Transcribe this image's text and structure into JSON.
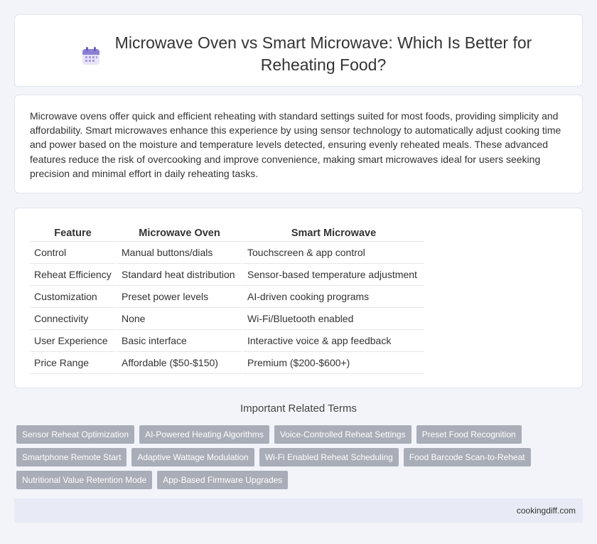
{
  "header": {
    "title": "Microwave Oven vs Smart Microwave: Which Is Better for Reheating Food?",
    "icon": "calendar-icon"
  },
  "intro": {
    "text": "Microwave ovens offer quick and efficient reheating with standard settings suited for most foods, providing simplicity and affordability. Smart microwaves enhance this experience by using sensor technology to automatically adjust cooking time and power based on the moisture and temperature levels detected, ensuring evenly reheated meals. These advanced features reduce the risk of overcooking and improve convenience, making smart microwaves ideal for users seeking precision and minimal effort in daily reheating tasks."
  },
  "table": {
    "headers": [
      "Feature",
      "Microwave Oven",
      "Smart Microwave"
    ],
    "rows": [
      [
        "Control",
        "Manual buttons/dials",
        "Touchscreen & app control"
      ],
      [
        "Reheat Efficiency",
        "Standard heat distribution",
        "Sensor-based temperature adjustment"
      ],
      [
        "Customization",
        "Preset power levels",
        "AI-driven cooking programs"
      ],
      [
        "Connectivity",
        "None",
        "Wi-Fi/Bluetooth enabled"
      ],
      [
        "User Experience",
        "Basic interface",
        "Interactive voice & app feedback"
      ],
      [
        "Price Range",
        "Affordable ($50-$150)",
        "Premium ($200-$600+)"
      ]
    ]
  },
  "related": {
    "title": "Important Related Terms",
    "tags": [
      "Sensor Reheat Optimization",
      "AI-Powered Heating Algorithms",
      "Voice-Controlled Reheat Settings",
      "Preset Food Recognition",
      "Smartphone Remote Start",
      "Adaptive Wattage Modulation",
      "Wi-Fi Enabled Reheat Scheduling",
      "Food Barcode Scan-to-Reheat",
      "Nutritional Value Retention Mode",
      "App-Based Firmware Upgrades"
    ]
  },
  "footer": {
    "site": "cookingdiff.com"
  }
}
